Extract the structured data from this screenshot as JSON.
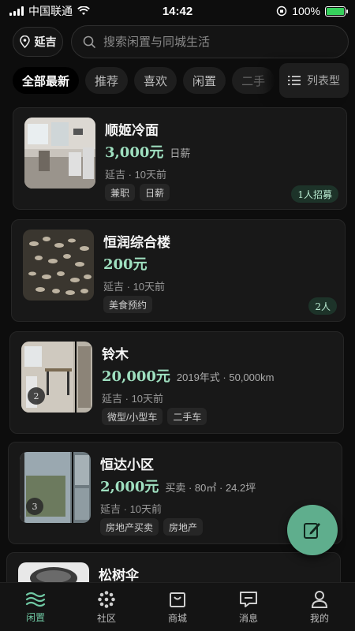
{
  "status_bar": {
    "carrier": "中国联通",
    "time": "14:42",
    "battery": "100%",
    "battery_level": 1.0
  },
  "header": {
    "location": "延吉",
    "search_placeholder": "搜索闲置与同城生活"
  },
  "tabs": [
    {
      "label": "全部最新",
      "active": true
    },
    {
      "label": "推荐"
    },
    {
      "label": "喜欢"
    },
    {
      "label": "闲置"
    },
    {
      "label": "二手"
    }
  ],
  "view_toggle": {
    "label": "列表型"
  },
  "cards": [
    {
      "title": "顺姬冷面",
      "price": "3,000元",
      "price_note": "日薪",
      "location": "延吉",
      "time": "10天前",
      "tags": [
        "兼职",
        "日薪"
      ],
      "badge": "1人招募"
    },
    {
      "title": "恒润综合楼",
      "price": "200元",
      "price_note": "",
      "location": "延吉",
      "time": "10天前",
      "tags": [
        "美食预约"
      ],
      "badge": "2人"
    },
    {
      "title": "铃木",
      "price": "20,000元",
      "price_note": "2019年式 · 50,000km",
      "location": "延吉",
      "time": "10天前",
      "tags": [
        "微型/小型车",
        "二手车"
      ],
      "image_count": "2"
    },
    {
      "title": "恒达小区",
      "price": "2,000元",
      "price_note": "买卖 · 80㎡ · 24.2坪",
      "location": "延吉",
      "time": "10天前",
      "tags": [
        "房地产买卖",
        "房地产"
      ],
      "image_count": "3"
    },
    {
      "title": "松树伞"
    }
  ],
  "nav": [
    {
      "label": "闲置",
      "icon": "wave-icon",
      "active": true
    },
    {
      "label": "社区",
      "icon": "dots-flower-icon"
    },
    {
      "label": "商城",
      "icon": "shopping-bag-icon"
    },
    {
      "label": "消息",
      "icon": "chat-icon"
    },
    {
      "label": "我的",
      "icon": "person-icon"
    }
  ],
  "colors": {
    "accent": "#6fc8a3",
    "price": "#9fe0c0",
    "fab": "#5fae8d",
    "background": "#0d0d0d",
    "card": "#181818"
  }
}
